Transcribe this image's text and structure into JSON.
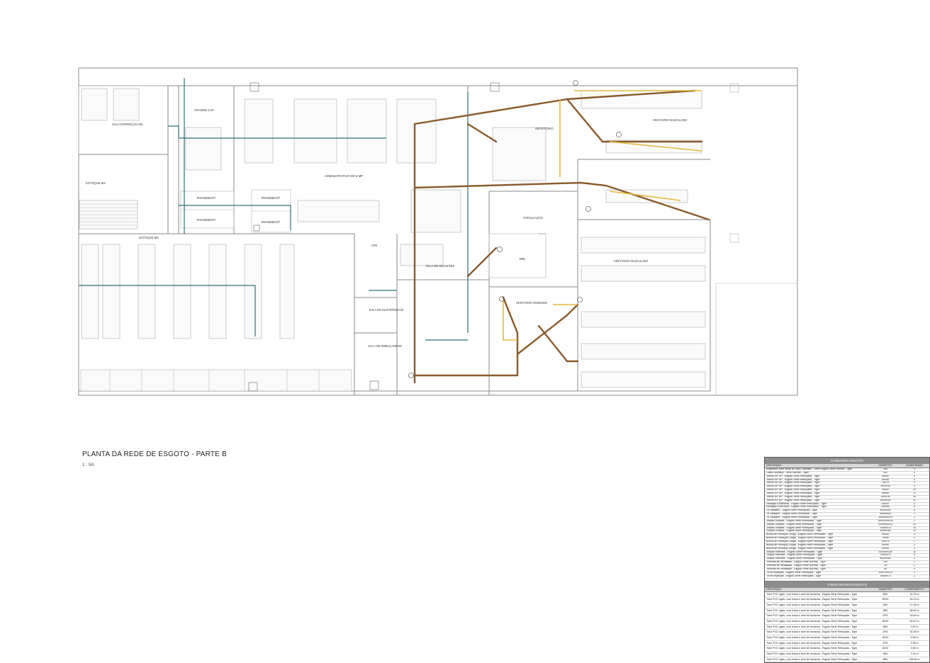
{
  "drawing": {
    "title": "PLANTA DA REDE DE ESGOTO  - PARTE B",
    "scale": "1 : 50"
  },
  "rooms": [
    {
      "id": "sala-expedicao",
      "label": "SALA EXPEDIÇÃO MX"
    },
    {
      "id": "grande-cap",
      "label": "GRANDE CAP"
    },
    {
      "id": "administrativo",
      "label": "ADMINISTRATIVO MX E MP"
    },
    {
      "id": "estoque-mx-1",
      "label": "ESTOQUE MX"
    },
    {
      "id": "estoque-mx-2",
      "label": "ESTOQUE MX"
    },
    {
      "id": "phonebooth-1",
      "label": "PHONEBOOT"
    },
    {
      "id": "phonebooth-2",
      "label": "PHONEBOOT"
    },
    {
      "id": "phonebooth-3",
      "label": "PHONEBOOT"
    },
    {
      "id": "phonebooth-4",
      "label": "PHONEBOOT"
    },
    {
      "id": "refeitorio",
      "label": "REFEITÓRIO"
    },
    {
      "id": "vestiario-masculino-1",
      "label": "VESTIÁRIO MASCULINO"
    },
    {
      "id": "vestiario-masculino-2",
      "label": "VESTIÁRIO MASCULINO"
    },
    {
      "id": "circulacao",
      "label": "CIRCULAÇÃO"
    },
    {
      "id": "cpd",
      "label": "CPD"
    },
    {
      "id": "sala-reunioes",
      "label": "SALA DE REUNIÕES"
    },
    {
      "id": "dml",
      "label": "DML"
    },
    {
      "id": "sala-eletronicos",
      "label": "SALA DE ELETRÔNICOS"
    },
    {
      "id": "sala-embalagens",
      "label": "SALA DE EMBALAGENS"
    },
    {
      "id": "vestiario-feminino",
      "label": "VESTIÁRIO FEMININO"
    }
  ],
  "legend": {
    "pipe_colors": {
      "primary": "#8a5a2b",
      "secondary": "#e2b93b",
      "tertiary": "#2f6e73"
    }
  },
  "schedule": {
    "connections": {
      "title": "CONEXÕES ESGOTO",
      "columns": [
        "DESCRIÇÃO",
        "DIÂMETRO",
        "QUANTIDADE"
      ],
      "rows": [
        [
          "Adaptador para Saída de Vaso Sanitário - Série Esgoto Série Normal - Tigre",
          "100",
          "3"
        ],
        [
          "Caixa Sifonada - Série Normal - Tigre",
          "100",
          "3"
        ],
        [
          "Joelho 45º NP - Esgoto Série Reforçada - Tigre",
          "40x40",
          "4"
        ],
        [
          "Joelho 45º NP - Esgoto Série Reforçada - Tigre",
          "50x50",
          "5"
        ],
        [
          "Joelho 45º NP - Esgoto Série Reforçada - Tigre",
          "75x75",
          "2"
        ],
        [
          "Joelho 45º NP - Esgoto Série Reforçada - Tigre",
          "100x100",
          "4"
        ],
        [
          "Joelho 90º NP - Esgoto Série Reforçada - Tigre",
          "40x40",
          "20"
        ],
        [
          "Joelho 90º NP - Esgoto Série Reforçada - Tigre",
          "50x50",
          "11"
        ],
        [
          "Joelho 90º NP - Esgoto Série Reforçada - Tigre",
          "100x100",
          "14"
        ],
        [
          "Joelho 90º NP - Esgoto Série Reforçada - Tigre",
          "40x40x40",
          "11"
        ],
        [
          "Redução Excêntrica - Esgoto Série Reforçada - Tigre",
          "50x40",
          "2"
        ],
        [
          "Redução Excêntrica - Esgoto Série Reforçada - Tigre",
          "100x50",
          "5"
        ],
        [
          "Tê Sanitário - Esgoto Série Reforçada - Tigre",
          "40x40x40",
          "4"
        ],
        [
          "Tê Sanitário - Esgoto Série Reforçada - Tigre",
          "50x40x50",
          "1"
        ],
        [
          "Tê Sanitário - Esgoto Série Reforçada - Tigre",
          "100x50x100",
          "1"
        ],
        [
          "Junção Simples - Esgoto Série Reforçada - Tigre",
          "100x100x100",
          "2"
        ],
        [
          "Junção Simples - Esgoto Série Reforçada - Tigre",
          "100x50x100",
          "12"
        ],
        [
          "Junção Simples - Esgoto Série Reforçada - Tigre",
          "75x50x75",
          "14"
        ],
        [
          "Junção Simples - Esgoto Série Reforçada - Tigre",
          "50x50x50",
          "12"
        ],
        [
          "Bucha de Redução Longa - Esgoto Série Reforçada - Tigre",
          "50x40",
          "3"
        ],
        [
          "Bucha de Redução Longa - Esgoto Série Reforçada - Tigre",
          "75x50",
          "2"
        ],
        [
          "Bucha de Redução Longa - Esgoto Série Reforçada - Tigre",
          "100x75",
          "1"
        ],
        [
          "Bucha de Redução Longa - Esgoto Série Reforçada - Tigre",
          "40x40",
          "1"
        ],
        [
          "Bucha de Redução Longa - Esgoto Série Reforçada - Tigre",
          "50x50",
          "1"
        ],
        [
          "Junção Invertida - Esgoto Série Reforçada - Tigre",
          "100x50x100",
          "11"
        ],
        [
          "Junção Invertida - Esgoto Série Reforçada - Tigre",
          "75x50x75",
          "4"
        ],
        [
          "Junção Invertida - Esgoto Série Reforçada - Tigre",
          "50x50x50",
          "2"
        ],
        [
          "Terminal de Ventilação - Esgoto Série Normal - Tigre",
          "100",
          "1"
        ],
        [
          "Terminal de Ventilação - Esgoto Série Normal - Tigre",
          "75",
          "2"
        ],
        [
          "Terminal de Ventilação - Esgoto Série Normal - Tigre",
          "50",
          "4"
        ],
        [
          "Tê de Inspeção - Esgoto Série Reforçada - Tigre",
          "100x75x100",
          "1"
        ],
        [
          "Tê de Inspeção - Esgoto Série Reforçada - Tigre",
          "75x50x75",
          "1"
        ]
      ]
    },
    "pipes": {
      "title": "TUBOS RÍGIDOS ESGOTO",
      "columns": [
        "DESCRIÇÃO",
        "DIÂMETRO",
        "COMPRIMENTO"
      ],
      "rows": [
        [
          "Tubo PVC rígido, com bolsa e anel de borracha - Esgoto Série Reforçada - Tigre",
          "Ø50",
          "24.33 m"
        ],
        [
          "Tubo PVC rígido, com bolsa e anel de borracha - Esgoto Série Reforçada - Tigre",
          "Ø100",
          "44.13 m"
        ],
        [
          "Tubo PVC rígido, com bolsa e anel de borracha - Esgoto Série Reforçada - Tigre",
          "Ø40",
          "17.36 m"
        ],
        [
          "Tubo PVC rígido, com bolsa e anel de borracha - Esgoto Série Reforçada - Tigre",
          "Ø50",
          "58.50 m"
        ],
        [
          "Tubo PVC rígido, com bolsa e anel de borracha - Esgoto Série Reforçada - Tigre",
          "Ø75",
          "16.60 m"
        ],
        [
          "Tubo PVC rígido, com bolsa e anel de borracha - Esgoto Série Reforçada - Tigre",
          "Ø100",
          "64.57 m"
        ],
        [
          "Tubo PVC rígido, com bolsa e anel de borracha - Esgoto Série Reforçada - Tigre",
          "Ø50",
          "3.20 m"
        ],
        [
          "Tubo PVC rígido, com bolsa e anel de borracha - Esgoto Série Reforçada - Tigre",
          "Ø75",
          "30.28 m"
        ],
        [
          "Tubo PVC rígido, com bolsa e anel de borracha - Esgoto Série Reforçada - Tigre",
          "Ø100",
          "3.36 m"
        ],
        [
          "Tubo PVC rígido, com bolsa e anel de borracha - Esgoto Série Reforçada - Tigre",
          "Ø75",
          "3.36 m"
        ],
        [
          "Tubo PVC rígido, com bolsa e anel de borracha - Esgoto Série Reforçada - Tigre",
          "Ø100",
          "3.36 m"
        ],
        [
          "Tubo PVC rígido, com bolsa e anel de borracha - Esgoto Série Reforçada - Tigre",
          "Ø40",
          "7.16 m"
        ],
        [
          "Tubo PVC rígido, com bolsa e anel de borracha - Esgoto Série Reforçada - Tigre",
          "Ø50",
          "196.65 m"
        ]
      ]
    }
  }
}
